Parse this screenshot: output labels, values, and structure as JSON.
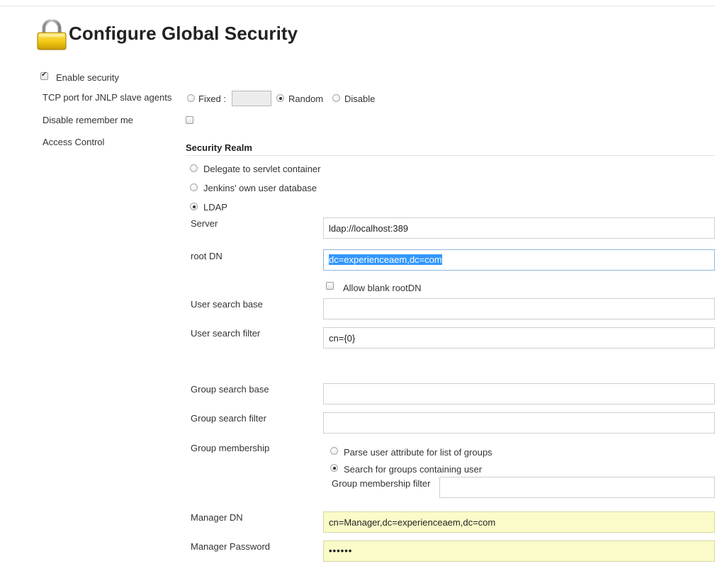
{
  "page": {
    "title": "Configure Global Security",
    "icon": "padlock-icon"
  },
  "options": {
    "enable_security": {
      "label": "Enable security",
      "checked": true
    },
    "tcp_port": {
      "label": "TCP port for JNLP slave agents",
      "fixed_label": "Fixed :",
      "fixed_value": "",
      "random_label": "Random",
      "disable_label": "Disable",
      "selected": "Random"
    },
    "disable_remember_me": {
      "label": "Disable remember me",
      "checked": false
    },
    "access_control": {
      "label": "Access Control"
    }
  },
  "security_realm": {
    "heading": "Security Realm",
    "choices": [
      {
        "label": "Delegate to servlet container",
        "selected": false
      },
      {
        "label": "Jenkins' own user database",
        "selected": false
      },
      {
        "label": "LDAP",
        "selected": true
      }
    ]
  },
  "ldap": {
    "server": {
      "label": "Server",
      "value": "ldap://localhost:389"
    },
    "root_dn": {
      "label": "root DN",
      "value": "dc=experienceaem,dc=com"
    },
    "allow_blank_rootdn": {
      "label": "Allow blank rootDN",
      "checked": false
    },
    "user_search_base": {
      "label": "User search base",
      "value": ""
    },
    "user_search_filter": {
      "label": "User search filter",
      "value": "cn={0}"
    },
    "group_search_base": {
      "label": "Group search base",
      "value": ""
    },
    "group_search_filter": {
      "label": "Group search filter",
      "value": ""
    },
    "group_membership": {
      "label": "Group membership",
      "options": [
        {
          "label": "Parse user attribute for list of groups",
          "selected": false
        },
        {
          "label": "Search for groups containing user",
          "selected": true
        }
      ],
      "filter_label": "Group membership filter",
      "filter_value": ""
    },
    "manager_dn": {
      "label": "Manager DN",
      "value": "cn=Manager,dc=experienceaem,dc=com"
    },
    "manager_password": {
      "label": "Manager Password",
      "value": "••••••"
    }
  },
  "colors": {
    "highlight_field": "#fbfbc9",
    "selection": "#3297fd",
    "lock_body": "#f2c811"
  }
}
